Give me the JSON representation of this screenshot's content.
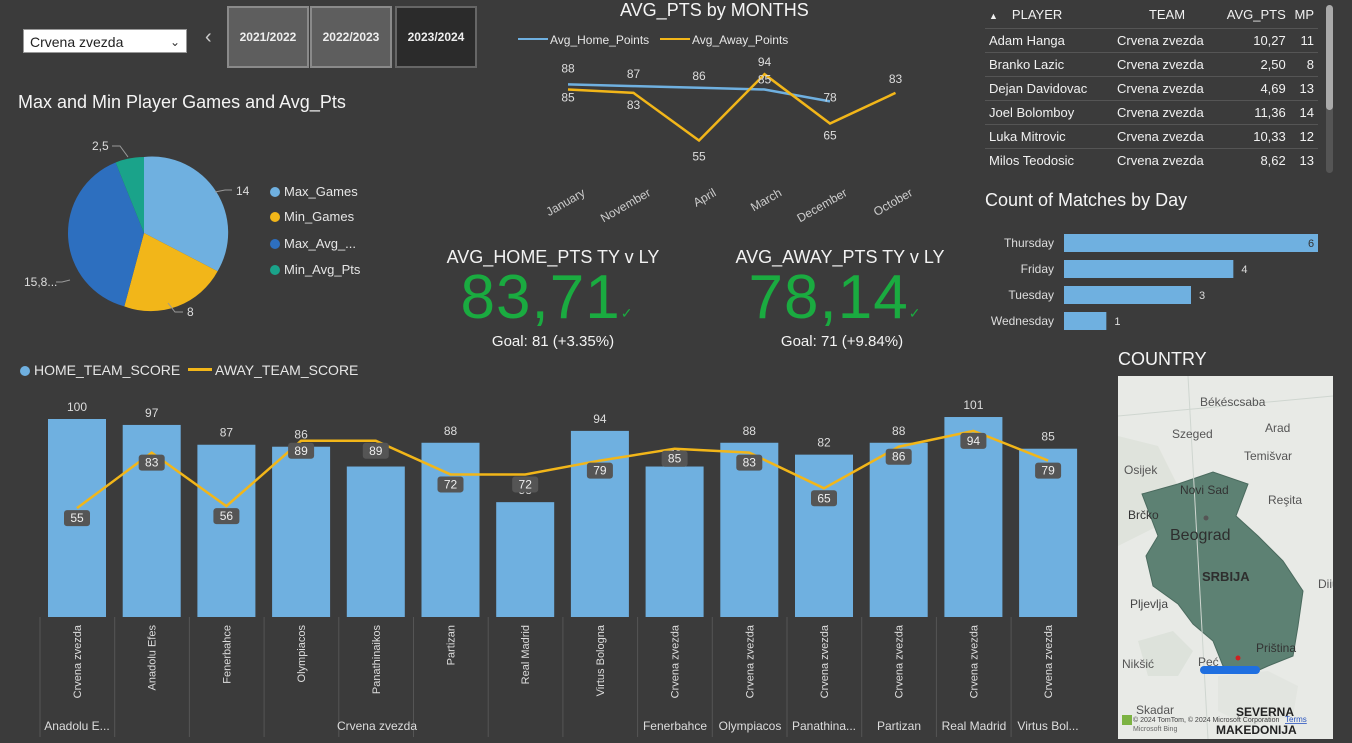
{
  "slicer": {
    "selected": "Crvena zvezda"
  },
  "seasons": [
    "2021/2022",
    "2022/2023",
    "2023/2024"
  ],
  "pie": {
    "title": "Max and Min Player Games and Avg_Pts",
    "legend": [
      "Max_Games",
      "Min_Games",
      "Max_Avg_...",
      "Min_Avg_Pts"
    ],
    "labels": [
      "14",
      "8",
      "15,8...",
      "2,5"
    ],
    "colors": [
      "#6fb0e0",
      "#f2b619",
      "#2d6fbf",
      "#1aa38a"
    ]
  },
  "months_chart": {
    "title": "AVG_PTS by MONTHS",
    "legend": [
      "Avg_Home_Points",
      "Avg_Away_Points"
    ],
    "colors": [
      "#6fb0e0",
      "#f2b619"
    ]
  },
  "chart_data": [
    {
      "type": "line",
      "title": "AVG_PTS by MONTHS",
      "categories": [
        "January",
        "November",
        "April",
        "March",
        "December",
        "October"
      ],
      "series": [
        {
          "name": "Avg_Home_Points",
          "values": [
            88,
            87,
            86,
            85,
            78,
            null
          ]
        },
        {
          "name": "Avg_Away_Points",
          "values": [
            85,
            83,
            55,
            94,
            65,
            83
          ]
        }
      ]
    },
    {
      "type": "pie",
      "title": "Max and Min Player Games and Avg_Pts",
      "categories": [
        "Max_Games",
        "Min_Games",
        "Max_Avg_Pts",
        "Min_Avg_Pts"
      ],
      "values": [
        14,
        8,
        15.8,
        2.5
      ]
    },
    {
      "type": "bar",
      "title": "Count of Matches by Day",
      "categories": [
        "Thursday",
        "Friday",
        "Tuesday",
        "Wednesday"
      ],
      "values": [
        6,
        4,
        3,
        1
      ]
    },
    {
      "type": "bar",
      "legend": [
        "HOME_TEAM_SCORE",
        "AWAY_TEAM_SCORE"
      ],
      "categories": [
        "Crvena zvezda",
        "Anadolu Efes",
        "Fenerbahce",
        "Olympiacos",
        "Panathinaikos",
        "Partizan",
        "Real Madrid",
        "Virtus Bologna",
        "Crvena zvezda",
        "Crvena zvezda",
        "Crvena zvezda",
        "Crvena zvezda",
        "Crvena zvezda",
        "Crvena zvezda"
      ],
      "groups": [
        "Anadolu E...",
        "Crvena zvezda",
        "Fenerbahce",
        "Olympiacos",
        "Panathina...",
        "Partizan",
        "Real Madrid",
        "Virtus Bol..."
      ],
      "series": [
        {
          "name": "HOME_TEAM_SCORE",
          "values": [
            100,
            97,
            87,
            86,
            76,
            88,
            58,
            94,
            76,
            88,
            82,
            88,
            101,
            85
          ]
        },
        {
          "name": "AWAY_TEAM_SCORE",
          "values": [
            55,
            83,
            56,
            89,
            89,
            72,
            72,
            79,
            85,
            83,
            65,
            86,
            94,
            79
          ]
        }
      ]
    }
  ],
  "kpis": [
    {
      "title": "AVG_HOME_PTS TY v LY",
      "value": "83,71",
      "goal": "Goal: 81 (+3.35%)"
    },
    {
      "title": "AVG_AWAY_PTS TY v LY",
      "value": "78,14",
      "goal": "Goal: 71 (+9.84%)"
    }
  ],
  "player_table": {
    "headers": [
      "PLAYER",
      "TEAM",
      "AVG_PTS",
      "MP"
    ],
    "rows": [
      [
        "Adam Hanga",
        "Crvena zvezda",
        "10,27",
        "11"
      ],
      [
        "Branko Lazic",
        "Crvena zvezda",
        "2,50",
        "8"
      ],
      [
        "Dejan Davidovac",
        "Crvena zvezda",
        "4,69",
        "13"
      ],
      [
        "Joel Bolomboy",
        "Crvena zvezda",
        "11,36",
        "14"
      ],
      [
        "Luka Mitrovic",
        "Crvena zvezda",
        "10,33",
        "12"
      ],
      [
        "Milos Teodosic",
        "Crvena zvezda",
        "8,62",
        "13"
      ]
    ]
  },
  "days_chart": {
    "title": "Count of Matches by Day"
  },
  "map": {
    "title": "COUNTRY",
    "cities": [
      "Békéscsaba",
      "Arad",
      "Szeged",
      "Temišvar",
      "Osijek",
      "Novi Sad",
      "Reşita",
      "Brčko",
      "Beograd",
      "SRBIJA",
      "Pljevlja",
      "Priština",
      "Nikšić",
      "Peć",
      "Skadar",
      "SEVERNA",
      "MAKEDONIJA",
      "Diiu"
    ],
    "attribution": "© 2024 TomTom, © 2024 Microsoft Corporation",
    "terms": "Terms",
    "bing": "Microsoft Bing"
  }
}
